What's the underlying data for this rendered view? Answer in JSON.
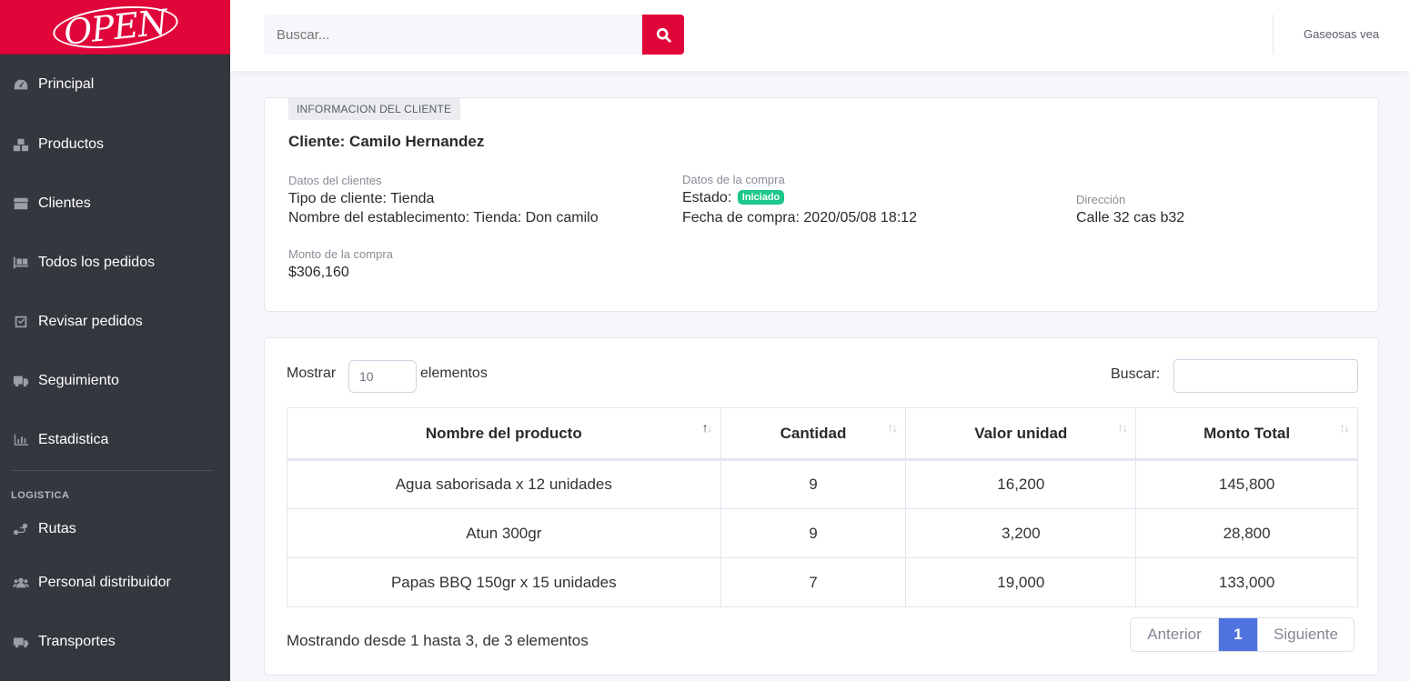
{
  "brand": {
    "logo_text": "OPEN",
    "color": "#e0063a"
  },
  "sidebar": {
    "items": [
      {
        "label": "Principal",
        "icon": "dashboard-icon"
      },
      {
        "label": "Productos",
        "icon": "boxes-icon"
      },
      {
        "label": "Clientes",
        "icon": "store-icon"
      },
      {
        "label": "Todos los pedidos",
        "icon": "pallet-icon"
      },
      {
        "label": "Revisar pedidos",
        "icon": "check-square-icon"
      },
      {
        "label": "Seguimiento",
        "icon": "truck-moving-icon"
      },
      {
        "label": "Estadistica",
        "icon": "chart-bar-icon"
      }
    ],
    "section_heading": "LOGISTICA",
    "logistics_items": [
      {
        "label": "Rutas",
        "icon": "route-icon"
      },
      {
        "label": "Personal distribuidor",
        "icon": "users-icon"
      },
      {
        "label": "Transportes",
        "icon": "truck-icon"
      }
    ]
  },
  "topbar": {
    "search_placeholder": "Buscar...",
    "user_name": "Gaseosas vea"
  },
  "client_card": {
    "tag": "INFORMACION DEL CLIENTE",
    "title": "Cliente: Camilo Hernandez",
    "datos_cliente_label": "Datos del clientes",
    "tipo_cliente": "Tipo de cliente: Tienda",
    "establecimiento": "Nombre del establecimento: Tienda: Don camilo",
    "datos_compra_label": "Datos de la compra",
    "estado_label": "Estado:",
    "estado_badge": "Iniciado",
    "fecha_compra": "Fecha de compra: 2020/05/08 18:12",
    "direccion_label": "Dirección",
    "direccion": "Calle 32 cas b32",
    "monto_label": "Monto de la compra",
    "monto": "$306,160"
  },
  "table_controls": {
    "show_label": "Mostrar",
    "page_length": "10",
    "show_suffix": "elementos",
    "filter_label": "Buscar:"
  },
  "table": {
    "columns": [
      "Nombre del producto",
      "Cantidad",
      "Valor unidad",
      "Monto Total"
    ],
    "rows": [
      [
        "Agua saborisada x 12 unidades",
        "9",
        "16,200",
        "145,800"
      ],
      [
        "Atun 300gr",
        "9",
        "3,200",
        "28,800"
      ],
      [
        "Papas BBQ 150gr x 15 unidades",
        "7",
        "19,000",
        "133,000"
      ]
    ]
  },
  "footer": {
    "info": "Mostrando desde 1 hasta 3, de 3 elementos",
    "prev": "Anterior",
    "page": "1",
    "next": "Siguiente"
  }
}
